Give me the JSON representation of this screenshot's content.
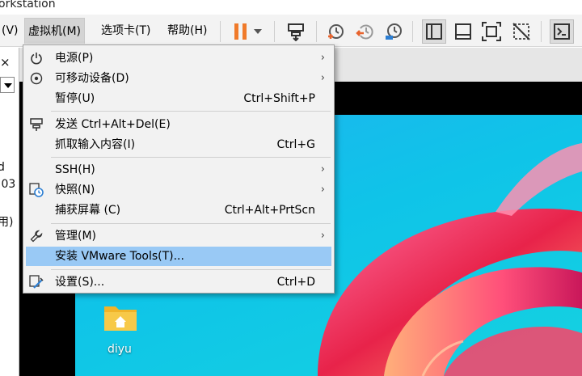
{
  "window": {
    "title_fragment": "orkstation"
  },
  "menubar": {
    "items": [
      {
        "label": "(V)"
      },
      {
        "label": "虚拟机(M)"
      },
      {
        "label": "选项卡(T)"
      },
      {
        "label": "帮助(H)"
      }
    ]
  },
  "toolbar": {
    "icons": [
      "pause-icon",
      "dropdown-arrow-icon",
      "send-ctrl-alt-del-icon",
      "snapshot-icon",
      "revert-snapshot-icon",
      "manage-snapshots-icon",
      "library-view-icon",
      "thumbnail-bar-icon",
      "fullscreen-icon",
      "unity-off-icon",
      "console-icon"
    ]
  },
  "left_panel": {
    "fragments": [
      "d",
      ".03",
      "用)"
    ]
  },
  "tab": {
    "close_glyph": "×"
  },
  "vm_menu": {
    "items": [
      {
        "label": "电源(P)",
        "shortcut": "",
        "submenu": true,
        "icon": "power-icon"
      },
      {
        "label": "可移动设备(D)",
        "shortcut": "",
        "submenu": true,
        "icon": "removable-device-icon"
      },
      {
        "label": "暂停(U)",
        "shortcut": "Ctrl+Shift+P",
        "submenu": false,
        "icon": ""
      },
      {
        "label": "发送 Ctrl+Alt+Del(E)",
        "shortcut": "",
        "submenu": false,
        "icon": "send-keys-icon"
      },
      {
        "label": "抓取输入内容(I)",
        "shortcut": "Ctrl+G",
        "submenu": false,
        "icon": ""
      },
      {
        "label": "SSH(H)",
        "shortcut": "",
        "submenu": true,
        "icon": ""
      },
      {
        "label": "快照(N)",
        "shortcut": "",
        "submenu": true,
        "icon": "snapshot-icon"
      },
      {
        "label": "捕获屏幕 (C)",
        "shortcut": "Ctrl+Alt+PrtScn",
        "submenu": false,
        "icon": ""
      },
      {
        "label": "管理(M)",
        "shortcut": "",
        "submenu": true,
        "icon": "wrench-icon"
      },
      {
        "label": "安装 VMware Tools(T)...",
        "shortcut": "",
        "submenu": false,
        "icon": "",
        "highlighted": true
      },
      {
        "label": "设置(S)...",
        "shortcut": "Ctrl+D",
        "submenu": false,
        "icon": "settings-icon"
      }
    ],
    "submenu_glyph": "›"
  },
  "desktop": {
    "icons": [
      {
        "label": "diyu",
        "icon": "folder-home-icon"
      }
    ]
  },
  "colors": {
    "highlight": "#99c9f5",
    "pause_orange": "#f07a2a",
    "snapshot_orange": "#e8632c",
    "desktop_cyan": "#15c8e6"
  }
}
